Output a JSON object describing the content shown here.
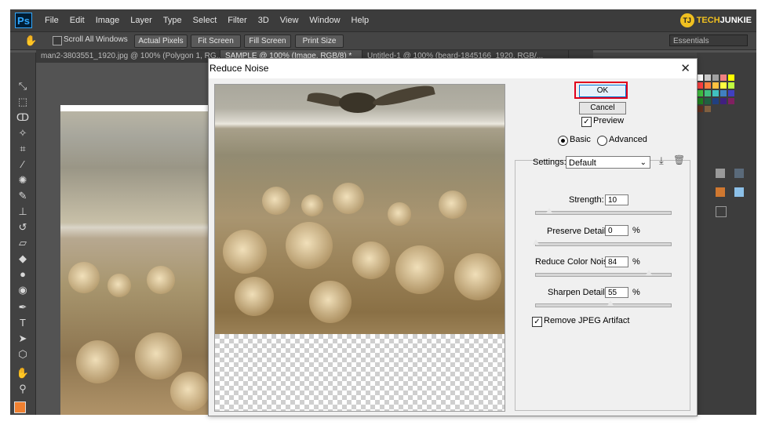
{
  "app": {
    "logo": "Ps",
    "menu": [
      "File",
      "Edit",
      "Image",
      "Layer",
      "Type",
      "Select",
      "Filter",
      "3D",
      "View",
      "Window",
      "Help"
    ],
    "watermark_initials": "TJ",
    "watermark_part1": "TECH",
    "watermark_part2": "JUNKIE"
  },
  "options_bar": {
    "scroll_all_windows": "Scroll All Windows",
    "actual_pixels": "Actual Pixels",
    "fit_screen": "Fit Screen",
    "fill_screen": "Fill Screen",
    "print_size": "Print Size",
    "workspace": "Essentials"
  },
  "tabs": [
    "man2-3803551_1920.jpg @ 100% (Polygon 1, RG...",
    "SAMPLE @ 100% (Image, RGB/8) *",
    "Untitled-1 @ 100% (beard-1845166_1920, RGB/..."
  ],
  "dialog": {
    "title": "Reduce Noise",
    "ok": "OK",
    "cancel": "Cancel",
    "preview_label": "Preview",
    "preview_checked": true,
    "mode_basic": "Basic",
    "mode_advanced": "Advanced",
    "mode_selected": "Basic",
    "settings_label": "Settings:",
    "settings_value": "Default",
    "strength_label": "Strength:",
    "strength_value": "10",
    "preserve_label": "Preserve Details:",
    "preserve_value": "0",
    "color_noise_label": "Reduce Color Noise:",
    "color_noise_value": "84",
    "sharpen_label": "Sharpen Details:",
    "sharpen_value": "55",
    "percent": "%",
    "jpeg_label": "Remove JPEG Artifact",
    "jpeg_checked": true,
    "sliders": {
      "strength": 10,
      "preserve": 0,
      "color_noise": 84,
      "sharpen": 55
    }
  },
  "colors": {
    "foreground": "#f08030",
    "ok_highlight": "#e0001c",
    "ps_blue": "#31a8ff"
  }
}
